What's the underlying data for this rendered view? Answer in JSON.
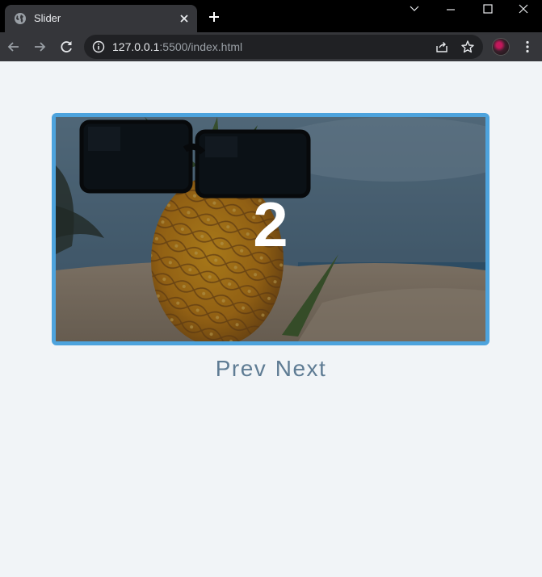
{
  "browser": {
    "tab_title": "Slider",
    "url_host": "127.0.0.1",
    "url_rest": ":5500/index.html"
  },
  "slider": {
    "current_slide": "2",
    "prev_label": "Prev",
    "next_label": "Next"
  },
  "colors": {
    "frame_border": "#4da3dd",
    "button_text": "#5f7c94",
    "page_background": "#f1f4f7"
  }
}
